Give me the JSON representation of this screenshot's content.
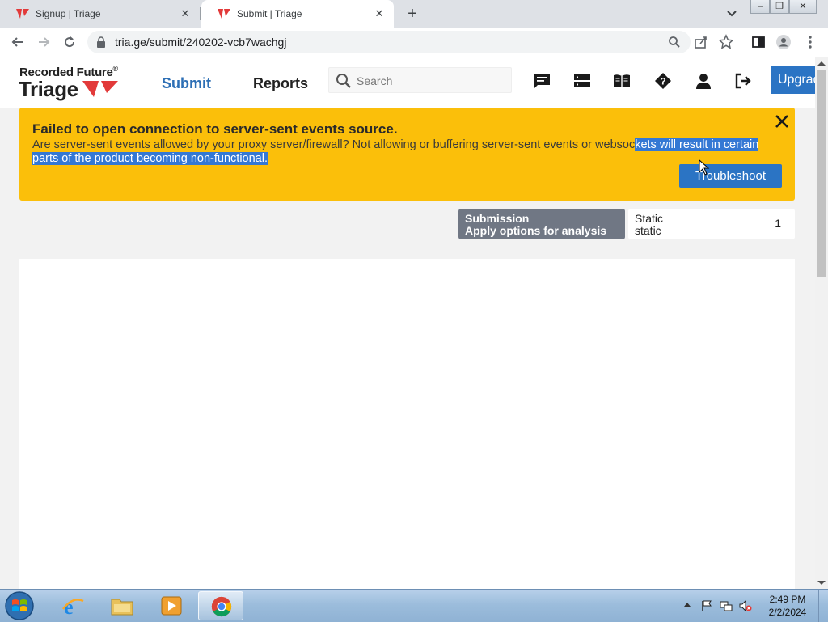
{
  "browser": {
    "tabs": [
      {
        "title": "Signup | Triage",
        "active": false
      },
      {
        "title": "Submit | Triage",
        "active": true
      }
    ],
    "url": "tria.ge/submit/240202-vcb7wachgj"
  },
  "header": {
    "brand_top": "Recorded Future",
    "brand_reg": "®",
    "brand_main": "Triage",
    "nav": {
      "submit": "Submit",
      "reports": "Reports"
    },
    "search_placeholder": "Search",
    "upgrade_label": "Upgrade",
    "icons": [
      "chat-icon",
      "server-icon",
      "book-icon",
      "help-icon",
      "user-icon",
      "logout-icon"
    ]
  },
  "alert": {
    "title": "Failed to open connection to server-sent events source.",
    "message_plain": "Are server-sent events allowed by your proxy server/firewall? Not allowing or buffering server-sent events or websoc",
    "message_selected": "kets will result in certain parts of the product becoming non-functional.",
    "button_label": "Troubleshoot"
  },
  "submission": {
    "title": "Submission",
    "subtitle": "Apply options for analysis",
    "static_label": "Static",
    "static_sub": "static",
    "static_count": "1"
  },
  "taskbar": {
    "time": "2:49 PM",
    "date": "2/2/2024"
  },
  "colors": {
    "alert_bg": "#fbbf0a",
    "primary": "#2b74c4",
    "nav_active": "#2d6fb5",
    "selection": "#3478d4",
    "brand_red": "#e23a3a"
  }
}
